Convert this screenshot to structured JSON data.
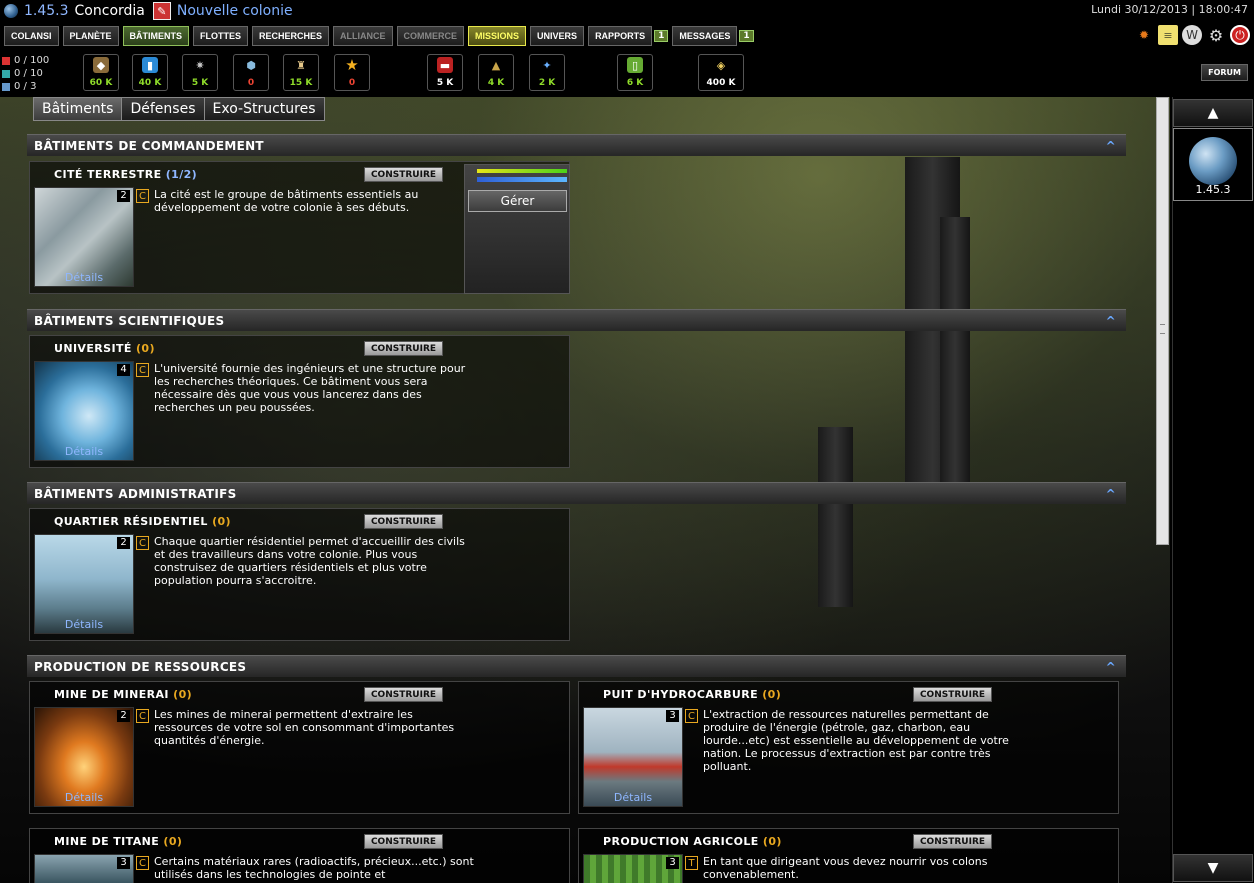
{
  "topbar": {
    "coords": "1.45.3",
    "planet_name": "Concordia",
    "colony_link": "Nouvelle colonie",
    "datetime": "Lundi 30/12/2013 | 18:00:47"
  },
  "nav": {
    "items": [
      "Colansi",
      "Planète",
      "Bâtiments",
      "Flottes",
      "Recherches",
      "Alliance",
      "Commerce",
      "Missions",
      "Univers",
      "Rapports",
      "Messages"
    ],
    "rapports_badge": "1",
    "messages_badge": "1"
  },
  "counters": {
    "c1": "0 / 100",
    "c2": "0 / 10",
    "c3": "0 / 3"
  },
  "resources": [
    {
      "icon": "ore-icon",
      "value": "60 K",
      "color": "green"
    },
    {
      "icon": "water-icon",
      "value": "40 K",
      "color": "green"
    },
    {
      "icon": "crystal-icon",
      "value": "5 K",
      "color": "green"
    },
    {
      "icon": "energy-icon",
      "value": "0",
      "color": "red"
    },
    {
      "icon": "radioactive-icon",
      "value": "15 K",
      "color": "green"
    },
    {
      "icon": "star-icon",
      "value": "0",
      "color": "red"
    },
    {
      "icon": "military-icon",
      "value": "5 K",
      "color": "white"
    },
    {
      "icon": "rank-icon",
      "value": "4 K",
      "color": "green"
    },
    {
      "icon": "science-icon",
      "value": "2 K",
      "color": "green"
    },
    {
      "icon": "food-icon",
      "value": "6 K",
      "color": "green"
    },
    {
      "icon": "money-icon",
      "value": "400 K",
      "color": "white"
    }
  ],
  "forum": "Forum",
  "tabs": [
    "Bâtiments",
    "Défenses",
    "Exo-Structures"
  ],
  "sections": {
    "commandement": "BÂTIMENTS DE COMMANDEMENT",
    "scientifiques": "BÂTIMENTS SCIENTIFIQUES",
    "administratifs": "BÂTIMENTS ADMINISTRATIFS",
    "production": "PRODUCTION DE RESSOURCES",
    "collapse": "^"
  },
  "buttons": {
    "construire": "CONSTRUIRE",
    "details": "Détails",
    "gerer": "Gérer"
  },
  "buildings": {
    "cite": {
      "name": "CITÉ TERRESTRE",
      "level": "(1/2)",
      "num": "2",
      "cat": "C",
      "desc": "La cité est le groupe de bâtiments essentiels au développement de votre colonie à ses débuts."
    },
    "universite": {
      "name": "UNIVERSITÉ",
      "level": "(0)",
      "num": "4",
      "cat": "C",
      "desc": "L'université fournie des ingénieurs et une structure pour les recherches théoriques. Ce bâtiment vous sera nécessaire dès que vous vous lancerez dans des recherches un peu poussées."
    },
    "quartier": {
      "name": "QUARTIER RÉSIDENTIEL",
      "level": "(0)",
      "num": "2",
      "cat": "C",
      "desc": "Chaque quartier résidentiel permet d'accueillir des civils et des travailleurs dans votre colonie. Plus vous construisez de quartiers résidentiels et plus votre population pourra s'accroitre."
    },
    "minerai": {
      "name": "MINE DE MINERAI",
      "level": "(0)",
      "num": "2",
      "cat": "C",
      "desc": "Les mines de minerai permettent d'extraire les ressources de votre sol en consommant d'importantes quantités d'énergie."
    },
    "hydrocarbure": {
      "name": "PUIT D'HYDROCARBURE",
      "level": "(0)",
      "num": "3",
      "cat": "C",
      "desc": "L'extraction de ressources naturelles permettant de produire de l'énergie (pétrole, gaz, charbon, eau lourde...etc) est essentielle au développement de votre nation. Le processus d'extraction est par contre très polluant."
    },
    "titane": {
      "name": "MINE DE TITANE",
      "level": "(0)",
      "num": "3",
      "cat": "C",
      "desc": "Certains matériaux rares (radioactifs, précieux...etc.) sont utilisés dans les technologies de pointe et"
    },
    "agricole": {
      "name": "PRODUCTION AGRICOLE",
      "level": "(0)",
      "num": "3",
      "cat": "T",
      "desc": "En tant que dirigeant vous devez nourrir vos colons convenablement."
    }
  },
  "right_panel": {
    "planet_coords": "1.45.3"
  }
}
